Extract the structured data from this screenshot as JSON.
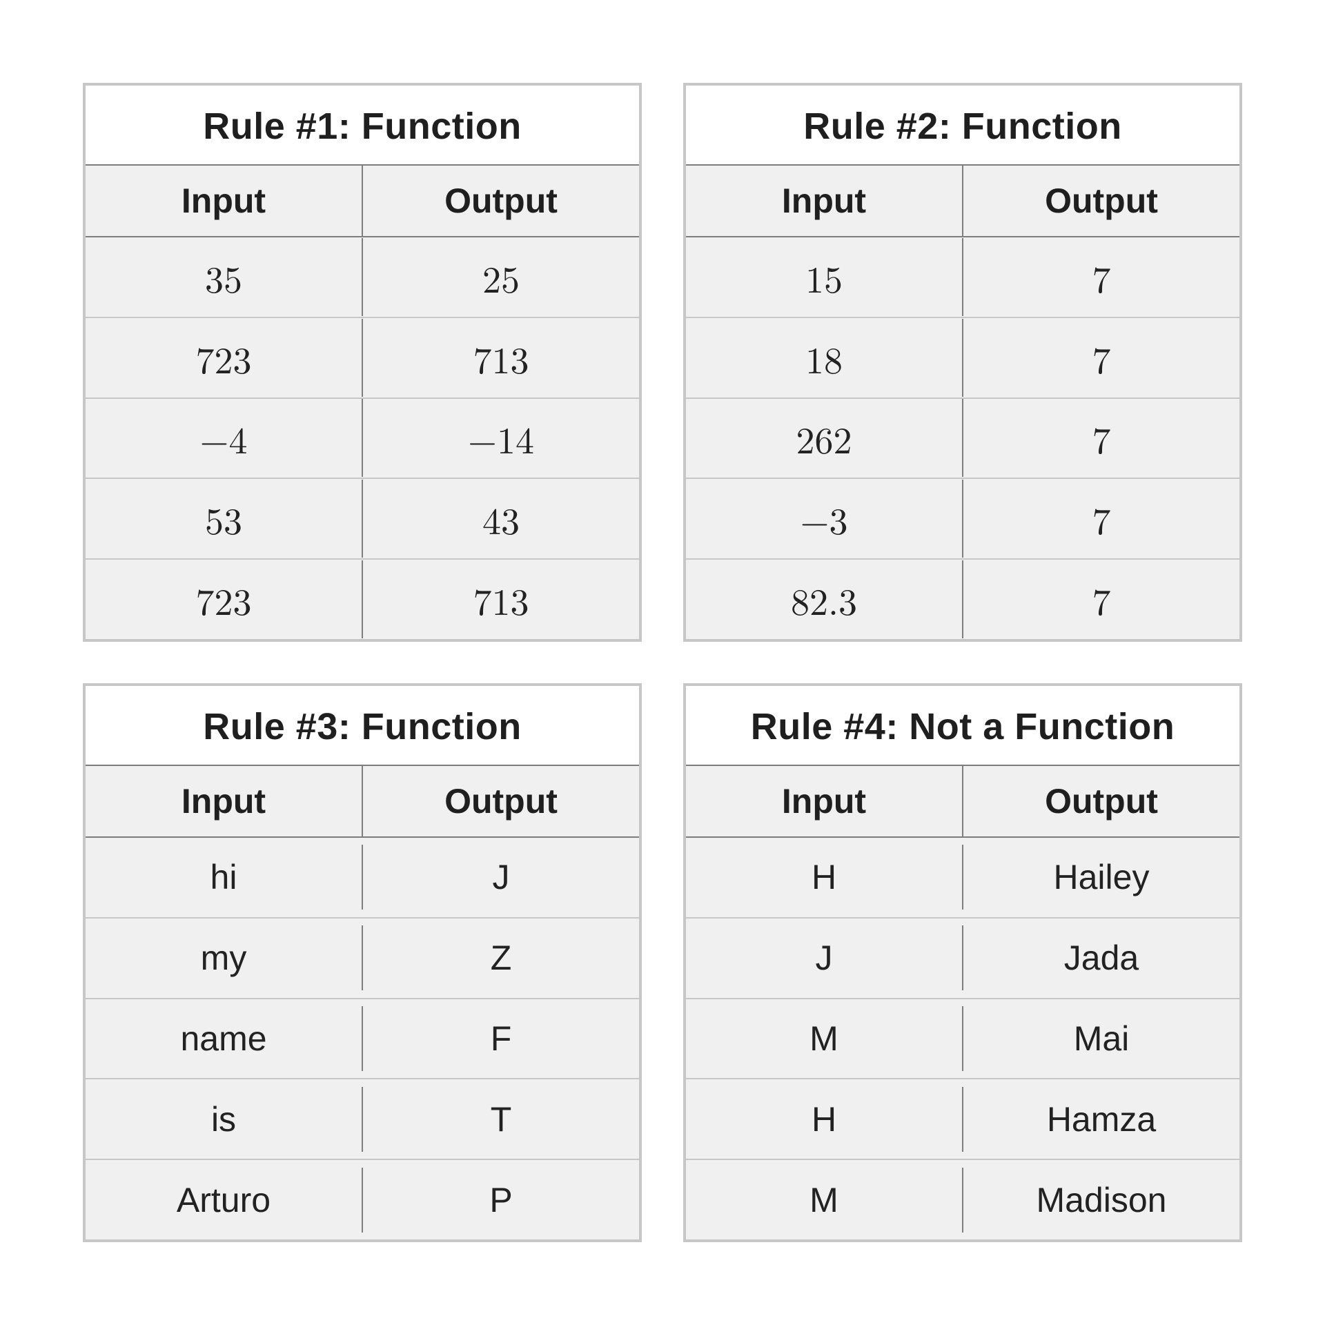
{
  "chart_data": [
    {
      "type": "table",
      "title": "Rule #1: Function",
      "columns": [
        "Input",
        "Output"
      ],
      "serif_numbers": true,
      "rows": [
        {
          "input": "35",
          "output": "25"
        },
        {
          "input": "723",
          "output": "713"
        },
        {
          "input": "−4",
          "output": "−14"
        },
        {
          "input": "53",
          "output": "43"
        },
        {
          "input": "723",
          "output": "713"
        }
      ]
    },
    {
      "type": "table",
      "title": "Rule #2: Function",
      "columns": [
        "Input",
        "Output"
      ],
      "serif_numbers": true,
      "rows": [
        {
          "input": "15",
          "output": "7"
        },
        {
          "input": "18",
          "output": "7"
        },
        {
          "input": "262",
          "output": "7"
        },
        {
          "input": "−3",
          "output": "7"
        },
        {
          "input": "82.3",
          "output": "7"
        }
      ]
    },
    {
      "type": "table",
      "title": "Rule #3: Function",
      "columns": [
        "Input",
        "Output"
      ],
      "serif_numbers": false,
      "rows": [
        {
          "input": "hi",
          "output": "J"
        },
        {
          "input": "my",
          "output": "Z"
        },
        {
          "input": "name",
          "output": "F"
        },
        {
          "input": "is",
          "output": "T"
        },
        {
          "input": "Arturo",
          "output": "P"
        }
      ]
    },
    {
      "type": "table",
      "title": "Rule #4: Not a Function",
      "columns": [
        "Input",
        "Output"
      ],
      "serif_numbers": false,
      "rows": [
        {
          "input": "H",
          "output": "Hailey"
        },
        {
          "input": "J",
          "output": "Jada"
        },
        {
          "input": "M",
          "output": "Mai"
        },
        {
          "input": "H",
          "output": "Hamza"
        },
        {
          "input": "M",
          "output": "Madison"
        }
      ]
    }
  ]
}
